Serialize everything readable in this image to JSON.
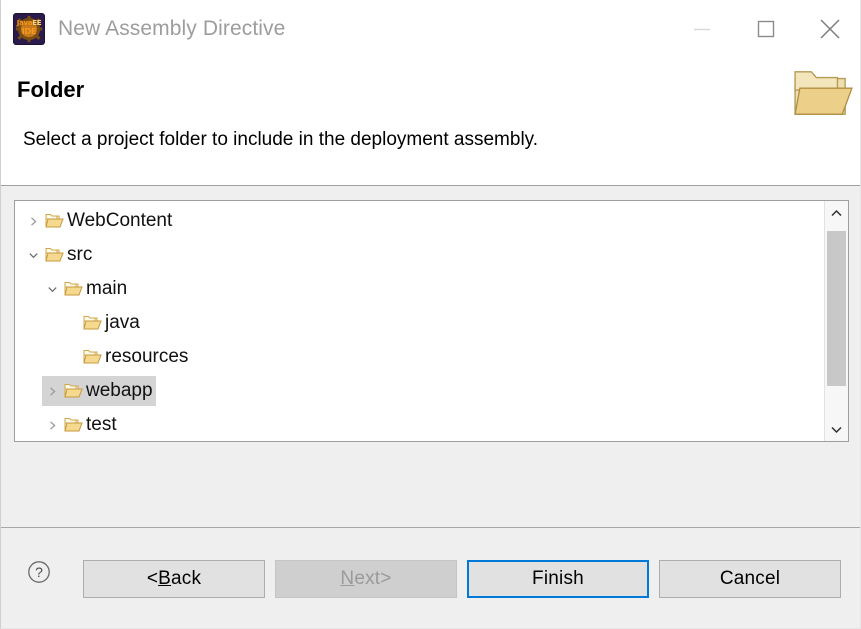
{
  "window": {
    "title": "New Assembly Directive",
    "app_icon": "java-ee-ide-icon",
    "icon_text_top": "Java",
    "icon_text_top2": "EE",
    "icon_text_bottom": "IDE",
    "controls": {
      "minimize": "minimize-icon",
      "maximize": "maximize-icon",
      "close": "close-icon"
    }
  },
  "header": {
    "heading": "Folder",
    "description": "Select a project folder to include in the deployment assembly.",
    "icon": "open-folder-icon"
  },
  "tree": {
    "nodes": [
      {
        "label": "WebContent",
        "indent": 0,
        "twisty": "collapsed",
        "selected": false,
        "icon": "folder-icon"
      },
      {
        "label": "src",
        "indent": 0,
        "twisty": "expanded",
        "selected": false,
        "icon": "folder-icon"
      },
      {
        "label": "main",
        "indent": 1,
        "twisty": "expanded",
        "selected": false,
        "icon": "folder-icon"
      },
      {
        "label": "java",
        "indent": 2,
        "twisty": "none",
        "selected": false,
        "icon": "folder-icon"
      },
      {
        "label": "resources",
        "indent": 2,
        "twisty": "none",
        "selected": false,
        "icon": "folder-icon"
      },
      {
        "label": "webapp",
        "indent": 1,
        "twisty": "collapsed",
        "selected": true,
        "icon": "folder-icon"
      },
      {
        "label": "test",
        "indent": 0,
        "twisty": "collapsed",
        "selected": false,
        "icon": "folder-icon"
      }
    ],
    "scrollbar": {
      "up_arrow": "chevron-up-icon",
      "down_arrow": "chevron-down-icon"
    }
  },
  "footer": {
    "help": "help-icon",
    "buttons": [
      {
        "key": "back",
        "prefix": "< ",
        "mnemonic": "B",
        "rest": "ack",
        "suffix": "",
        "state": "normal"
      },
      {
        "key": "next",
        "prefix": "",
        "mnemonic": "N",
        "rest": "ext",
        "suffix": " >",
        "state": "disabled"
      },
      {
        "key": "finish",
        "prefix": "",
        "mnemonic": "",
        "rest": "Finish",
        "suffix": "",
        "state": "focus"
      },
      {
        "key": "cancel",
        "prefix": "",
        "mnemonic": "",
        "rest": "Cancel",
        "suffix": "",
        "state": "normal"
      }
    ]
  },
  "colors": {
    "accent": "#0078d7",
    "dialog_bg": "#efefef",
    "panel_bg": "#ffffff",
    "selection": "#d4d4d4",
    "folder_gold": "#e8c06a",
    "title_text": "#9d9d9d"
  }
}
